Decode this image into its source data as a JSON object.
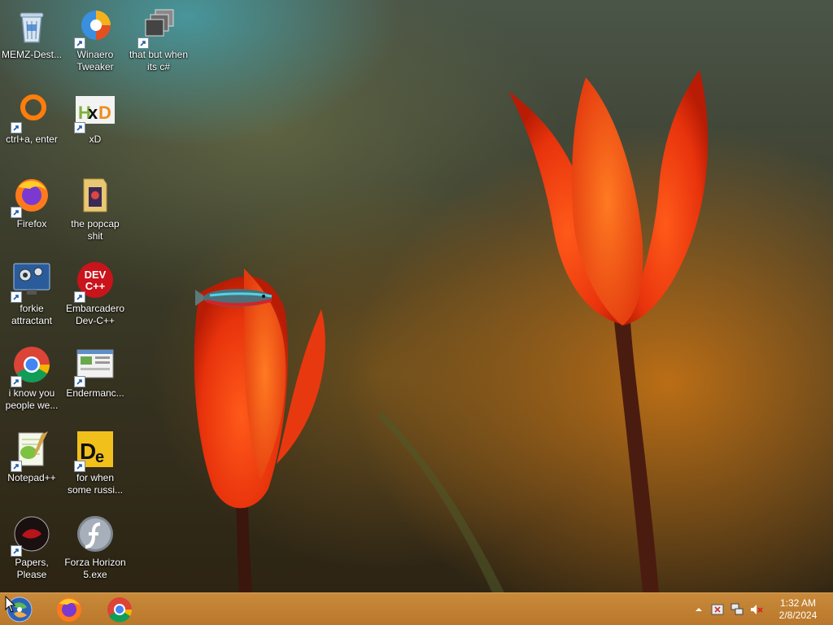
{
  "desktop": {
    "icons": [
      {
        "label": "MEMZ-Dest...",
        "icon": "recycle-bin-icon"
      },
      {
        "label": "Winaero Tweaker",
        "icon": "winaero-tweaker-icon"
      },
      {
        "label": "that but when its c#",
        "icon": "stacked-windows-icon"
      },
      {
        "label": "ctrl+a, enter",
        "icon": "orange-ring-icon"
      },
      {
        "label": "xD",
        "icon": "hxd-icon"
      },
      {
        "label": "Firefox",
        "icon": "firefox-icon"
      },
      {
        "label": "the popcap shit",
        "icon": "folder-icon"
      },
      {
        "label": "forkie attractant",
        "icon": "settings-monitor-icon"
      },
      {
        "label": "Embarcadero Dev-C++",
        "icon": "devcpp-icon"
      },
      {
        "label": "i know you people we...",
        "icon": "chrome-icon"
      },
      {
        "label": "Endermanc...",
        "icon": "window-app-icon"
      },
      {
        "label": "Notepad++",
        "icon": "notepadpp-icon"
      },
      {
        "label": "for when some russi...",
        "icon": "de-icon"
      },
      {
        "label": "Papers, Please",
        "icon": "papers-please-icon"
      },
      {
        "label": "Forza Horizon 5.exe",
        "icon": "flash-icon"
      }
    ]
  },
  "taskbar": {
    "start_icon": "start-orb-icon",
    "pinned": [
      {
        "name": "firefox",
        "icon": "firefox-icon"
      },
      {
        "name": "chrome",
        "icon": "chrome-icon"
      }
    ],
    "tray": [
      "show-hidden-icons",
      "action-center-flag-icon",
      "network-icon",
      "volume-muted-icon"
    ],
    "clock": {
      "time": "1:32 AM",
      "date": "2/8/2024"
    }
  },
  "colors": {
    "taskbar": "#c0802f",
    "label_text": "#ffffff"
  }
}
